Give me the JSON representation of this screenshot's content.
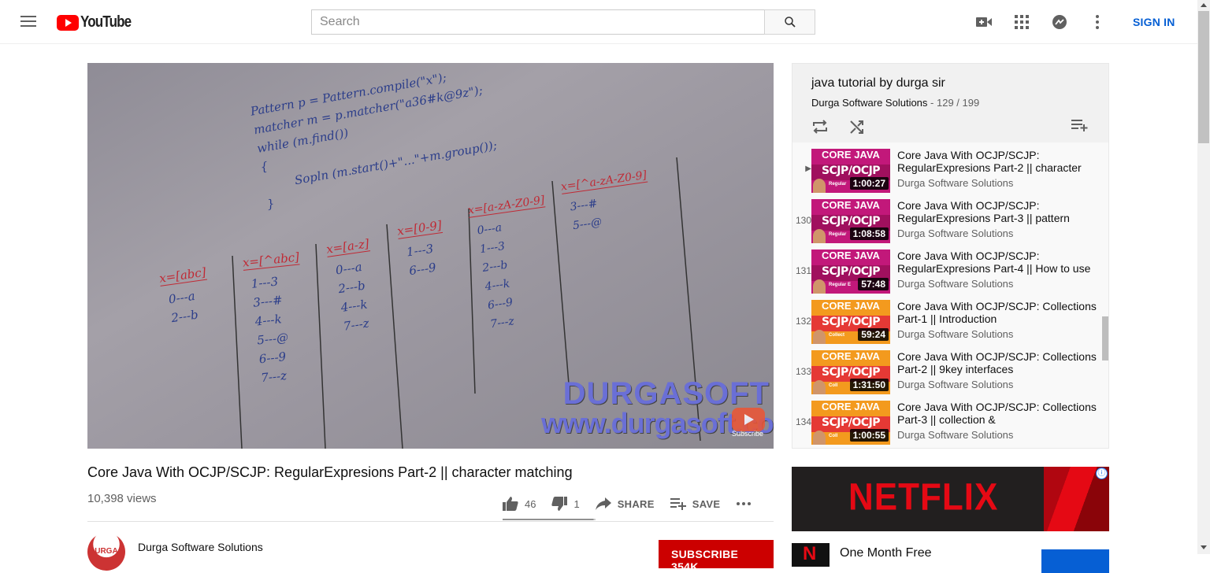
{
  "header": {
    "logo_text": "YouTube",
    "search_placeholder": "Search",
    "sign_in_label": "SIGN IN"
  },
  "player": {
    "whiteboard": {
      "code_lines": [
        "Pattern p = Pattern.compile(\"x\");",
        "matcher m = p.matcher(\"a36#k@9z\");",
        "while (m.find())",
        "{",
        "Sopln (m.start()+\"...\"+m.group());",
        "}"
      ],
      "columns": [
        {
          "pattern": "x=[abc]",
          "rows": [
            "0---a",
            "2---b"
          ]
        },
        {
          "pattern": "x=[^abc]",
          "rows": [
            "1---3",
            "3---#",
            "4---k",
            "5---@",
            "6---9",
            "7---z"
          ]
        },
        {
          "pattern": "x=[a-z]",
          "rows": [
            "0---a",
            "2---b",
            "4---k",
            "7---z"
          ]
        },
        {
          "pattern": "x=[0-9]",
          "rows": [
            "1---3",
            "6---9"
          ]
        },
        {
          "pattern": "x=[a-zA-Z0-9]",
          "rows": [
            "0---a",
            "1---3",
            "2---b",
            "4---k",
            "6---9",
            "7---z"
          ]
        },
        {
          "pattern": "x=[^a-zA-Z0-9]",
          "rows": [
            "3---#",
            "5---@"
          ]
        }
      ]
    },
    "watermark_line1": "DURGASOFT",
    "watermark_line2": "www.durgasoft.com",
    "subscribe_overlay": "Subscribe"
  },
  "video": {
    "title": "Core Java With OCJP/SCJP: RegularExpresions Part-2 || character matching",
    "views": "10,398 views",
    "likes": "46",
    "dislikes": "1",
    "like_ratio": 0.98,
    "share_label": "SHARE",
    "save_label": "SAVE"
  },
  "channel": {
    "name": "Durga Software Solutions",
    "avatar_text": "DURGA",
    "subscribe_label": "SUBSCRIBE 354K"
  },
  "playlist": {
    "title": "java tutorial by durga sir",
    "owner": "Durga Software Solutions",
    "position": "129 / 199",
    "items": [
      {
        "index": "▶",
        "title": "Core Java With OCJP/SCJP: RegularExpresions Part-2 || character",
        "channel": "Durga Software Solutions",
        "duration": "1:00:27",
        "thumb_top": "CORE JAVA",
        "thumb_mid": "SCJP/OCJP",
        "thumb_tag": "Regular",
        "thumb_color": "#c2187a",
        "current": true
      },
      {
        "index": "130",
        "title": "Core Java With OCJP/SCJP: RegularExpresions Part-3 || pattern",
        "channel": "Durga Software Solutions",
        "duration": "1:08:58",
        "thumb_top": "CORE JAVA",
        "thumb_mid": "SCJP/OCJP",
        "thumb_tag": "Regular",
        "thumb_color": "#c2187a",
        "current": false
      },
      {
        "index": "131",
        "title": "Core Java With OCJP/SCJP: RegularExpresions Part-4 || How to use",
        "channel": "Durga Software Solutions",
        "duration": "57:48",
        "thumb_top": "CORE JAVA",
        "thumb_mid": "SCJP/OCJP",
        "thumb_tag": "Regular E",
        "thumb_color": "#c2187a",
        "current": false
      },
      {
        "index": "132",
        "title": "Core Java With OCJP/SCJP: Collections Part-1 || Introduction",
        "channel": "Durga Software Solutions",
        "duration": "59:24",
        "thumb_top": "CORE JAVA",
        "thumb_mid": "SCJP/OCJP",
        "thumb_tag": "Collect",
        "thumb_color": "#f39a1e",
        "current": false
      },
      {
        "index": "133",
        "title": "Core Java With OCJP/SCJP: Collections Part-2 || 9key interfaces",
        "channel": "Durga Software Solutions",
        "duration": "1:31:50",
        "thumb_top": "CORE JAVA",
        "thumb_mid": "SCJP/OCJP",
        "thumb_tag": "Coll",
        "thumb_color": "#f39a1e",
        "current": false
      },
      {
        "index": "134",
        "title": "Core Java With OCJP/SCJP: Collections Part-3 || collection &",
        "channel": "Durga Software Solutions",
        "duration": "1:00:55",
        "thumb_top": "CORE JAVA",
        "thumb_mid": "SCJP/OCJP",
        "thumb_tag": "Coll",
        "thumb_color": "#f39a1e",
        "current": false
      }
    ]
  },
  "ad": {
    "brand": "NETFLIX",
    "info_icon": "ⓘ",
    "second_line": "One Month Free"
  },
  "colors": {
    "accent_red": "#ff0000",
    "link_blue": "#065fd4",
    "subscribe_red": "#cc0000",
    "netflix_red": "#e50914"
  }
}
